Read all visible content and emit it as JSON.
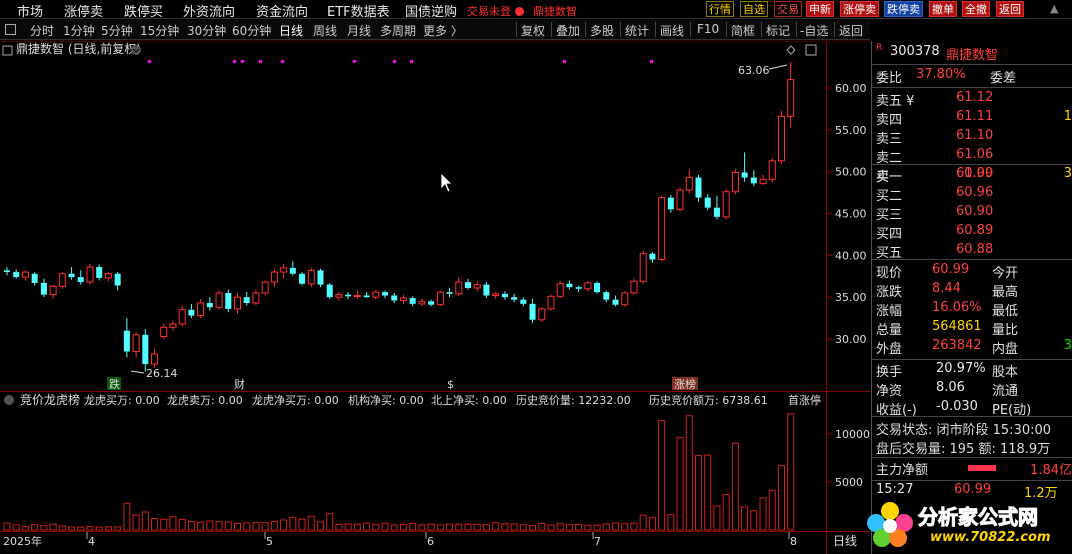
{
  "menu": {
    "items": [
      "市场",
      "涨停卖",
      "跌停买",
      "外资流向",
      "资金流向",
      "ETF数据表",
      "国债逆购"
    ],
    "notice": "交易未登",
    "stock_name": "鼎捷数智",
    "buttons": [
      "行情",
      "自选",
      "交易",
      "申新",
      "涨停卖",
      "跌停卖",
      "撤单",
      "全撤",
      "返回"
    ]
  },
  "periods": {
    "items": [
      "分时",
      "1分钟",
      "5分钟",
      "15分钟",
      "30分钟",
      "60分钟",
      "日线",
      "周线",
      "月线",
      "多周期",
      "更多 〉"
    ],
    "active": "日线",
    "tools": [
      "复权",
      "叠加",
      "多股",
      "统计",
      "画线",
      "F10",
      "简框",
      "标记",
      "-自选",
      "返回"
    ]
  },
  "chart": {
    "title": "鼎捷数智 (日线,前复权)",
    "high_label": "63.06",
    "low_label": "26.14",
    "price_ticks": [
      "60.00",
      "55.00",
      "50.00",
      "45.00",
      "40.00",
      "35.00",
      "30.00"
    ],
    "event_markers": [
      "跌",
      "财",
      "$",
      "涨榜"
    ],
    "indicator_name": "竞价龙虎榜",
    "indicator_fields": [
      {
        "label": "龙虎买万:",
        "value": "0.00",
        "color": "#e8e8e8"
      },
      {
        "label": "龙虎卖万:",
        "value": "0.00",
        "color": "#30a0ff"
      },
      {
        "label": "龙虎净买万:",
        "value": "0.00",
        "color": "#c040ff"
      },
      {
        "label": "机构净买:",
        "value": "0.00",
        "color": "#ff4040"
      },
      {
        "label": "北上净买:",
        "value": "0.00",
        "color": "#888888"
      },
      {
        "label": "历史竞价量:",
        "value": "12232.00",
        "color": "#3060ff"
      },
      {
        "label": "历史竞价额万:",
        "value": "6738.61",
        "color": "#e8e8e8"
      },
      {
        "label": "首涨停",
        "value": "",
        "color": "#ffd400"
      }
    ],
    "volume_ticks": [
      "10000",
      "5000"
    ],
    "date_labels": [
      "2025年",
      "4",
      "5",
      "6",
      "7",
      "8"
    ],
    "period_label": "日线"
  },
  "chart_data": {
    "type": "candlestick",
    "y_price_range": [
      26,
      64
    ],
    "y_volume_range": [
      0,
      13000
    ],
    "candles": [
      [
        38.2,
        38.6,
        37.6,
        38.0
      ],
      [
        38.0,
        38.3,
        37.2,
        37.4
      ],
      [
        37.4,
        38.2,
        37.0,
        38.0
      ],
      [
        37.8,
        38.0,
        36.4,
        36.7
      ],
      [
        36.7,
        37.2,
        35.0,
        35.3
      ],
      [
        35.3,
        36.5,
        34.8,
        36.3
      ],
      [
        36.3,
        38.0,
        36.0,
        37.8
      ],
      [
        37.8,
        38.6,
        37.1,
        37.4
      ],
      [
        37.4,
        38.2,
        36.5,
        36.8
      ],
      [
        36.8,
        39.0,
        36.5,
        38.6
      ],
      [
        38.6,
        38.9,
        37.0,
        37.3
      ],
      [
        37.3,
        38.0,
        36.9,
        37.8
      ],
      [
        37.8,
        38.0,
        35.8,
        36.4
      ],
      [
        31.0,
        32.5,
        27.8,
        28.5
      ],
      [
        28.5,
        30.8,
        27.8,
        30.5
      ],
      [
        30.5,
        31.2,
        26.1,
        27.0
      ],
      [
        27.0,
        28.8,
        26.6,
        28.2
      ],
      [
        30.3,
        31.8,
        30.0,
        31.4
      ],
      [
        31.4,
        32.2,
        31.0,
        31.8
      ],
      [
        31.8,
        34.0,
        31.5,
        33.5
      ],
      [
        33.5,
        34.2,
        32.5,
        32.8
      ],
      [
        32.8,
        34.8,
        32.5,
        34.3
      ],
      [
        34.3,
        35.0,
        33.4,
        33.8
      ],
      [
        33.8,
        35.8,
        33.5,
        35.5
      ],
      [
        35.5,
        35.9,
        33.2,
        33.6
      ],
      [
        33.6,
        35.5,
        33.0,
        35.0
      ],
      [
        35.0,
        35.6,
        34.0,
        34.3
      ],
      [
        34.3,
        35.9,
        34.0,
        35.5
      ],
      [
        35.5,
        37.0,
        35.2,
        36.8
      ],
      [
        36.8,
        38.4,
        36.2,
        38.0
      ],
      [
        38.0,
        39.0,
        37.3,
        38.5
      ],
      [
        38.5,
        39.3,
        37.6,
        37.8
      ],
      [
        37.8,
        38.0,
        36.4,
        36.6
      ],
      [
        36.6,
        38.5,
        36.2,
        38.2
      ],
      [
        38.2,
        38.4,
        36.2,
        36.5
      ],
      [
        36.5,
        36.7,
        34.8,
        35.0
      ],
      [
        35.0,
        35.6,
        34.6,
        35.3
      ],
      [
        35.3,
        35.6,
        34.8,
        35.1
      ],
      [
        35.1,
        35.8,
        34.8,
        35.2
      ],
      [
        35.2,
        35.6,
        34.9,
        35.0
      ],
      [
        35.0,
        35.9,
        34.7,
        35.6
      ],
      [
        35.6,
        35.8,
        34.9,
        35.2
      ],
      [
        35.2,
        35.5,
        34.3,
        34.6
      ],
      [
        34.6,
        35.3,
        34.2,
        34.9
      ],
      [
        34.9,
        35.1,
        33.9,
        34.2
      ],
      [
        34.2,
        34.8,
        33.9,
        34.5
      ],
      [
        34.5,
        34.7,
        33.9,
        34.1
      ],
      [
        34.1,
        35.8,
        33.9,
        35.6
      ],
      [
        35.6,
        36.1,
        35.0,
        35.4
      ],
      [
        35.4,
        37.4,
        35.1,
        36.8
      ],
      [
        36.8,
        37.2,
        35.9,
        36.1
      ],
      [
        36.1,
        36.9,
        35.7,
        36.5
      ],
      [
        36.5,
        36.8,
        34.9,
        35.2
      ],
      [
        35.2,
        35.6,
        34.8,
        35.4
      ],
      [
        35.4,
        35.7,
        34.7,
        35.0
      ],
      [
        35.0,
        35.4,
        34.4,
        34.7
      ],
      [
        34.7,
        35.0,
        33.9,
        34.2
      ],
      [
        34.2,
        34.8,
        31.9,
        32.3
      ],
      [
        32.3,
        33.8,
        32.1,
        33.6
      ],
      [
        33.6,
        35.3,
        33.4,
        35.1
      ],
      [
        35.1,
        36.9,
        34.9,
        36.6
      ],
      [
        36.6,
        37.0,
        35.9,
        36.2
      ],
      [
        36.2,
        36.4,
        35.6,
        36.0
      ],
      [
        36.0,
        36.9,
        35.7,
        36.7
      ],
      [
        36.7,
        36.9,
        35.4,
        35.6
      ],
      [
        35.6,
        35.8,
        34.4,
        34.7
      ],
      [
        34.7,
        35.2,
        33.9,
        34.1
      ],
      [
        34.1,
        35.7,
        33.9,
        35.5
      ],
      [
        35.5,
        37.2,
        35.3,
        36.9
      ],
      [
        36.9,
        40.6,
        36.6,
        40.2
      ],
      [
        40.2,
        40.4,
        39.1,
        39.5
      ],
      [
        39.5,
        47.1,
        39.3,
        46.9
      ],
      [
        46.9,
        47.2,
        45.1,
        45.5
      ],
      [
        45.5,
        48.2,
        45.2,
        47.8
      ],
      [
        47.8,
        50.3,
        47.4,
        49.3
      ],
      [
        49.3,
        49.6,
        46.4,
        46.9
      ],
      [
        46.9,
        47.3,
        45.4,
        45.7
      ],
      [
        45.7,
        47.1,
        44.3,
        44.6
      ],
      [
        44.6,
        47.9,
        44.3,
        47.6
      ],
      [
        47.6,
        50.3,
        47.3,
        49.9
      ],
      [
        49.9,
        52.3,
        48.8,
        49.3
      ],
      [
        49.3,
        50.2,
        48.3,
        48.6
      ],
      [
        48.6,
        49.6,
        48.4,
        49.1
      ],
      [
        49.1,
        51.6,
        48.7,
        51.3
      ],
      [
        51.3,
        57.3,
        50.9,
        56.6
      ],
      [
        56.6,
        63.1,
        55.3,
        61.0
      ]
    ],
    "volumes": [
      720,
      540,
      360,
      550,
      470,
      610,
      420,
      320,
      300,
      370,
      310,
      330,
      320,
      2750,
      1560,
      1880,
      1200,
      1120,
      1380,
      1100,
      880,
      820,
      930,
      870,
      830,
      700,
      740,
      780,
      760,
      880,
      1050,
      1320,
      1130,
      1430,
      860,
      1700,
      580,
      640,
      600,
      710,
      600,
      700,
      520,
      560,
      690,
      540,
      620,
      530,
      600,
      610,
      610,
      590,
      550,
      760,
      660,
      640,
      550,
      470,
      690,
      510,
      660,
      590,
      580,
      500,
      500,
      640,
      730,
      650,
      720,
      1550,
      1280,
      11400,
      1600,
      9650,
      11900,
      7750,
      7800,
      2500,
      3700,
      9050,
      2400,
      2000,
      3350,
      4150,
      6700,
      12100
    ]
  },
  "panel": {
    "code": "300378",
    "name": "鼎捷数智",
    "wei_bi_label": "委比",
    "wei_bi": "37.80%",
    "wei_cha_label": "委差",
    "sell": [
      {
        "label": "卖五 ¥",
        "price": "61.12",
        "vol": ""
      },
      {
        "label": "卖四",
        "price": "61.11",
        "vol": "1"
      },
      {
        "label": "卖三",
        "price": "61.10",
        "vol": ""
      },
      {
        "label": "卖二",
        "price": "61.06",
        "vol": ""
      },
      {
        "label": "卖一",
        "price": "61.00",
        "vol": ""
      }
    ],
    "buy": [
      {
        "label": "买一",
        "price": "60.99",
        "vol": "3"
      },
      {
        "label": "买二",
        "price": "60.96",
        "vol": ""
      },
      {
        "label": "买三",
        "price": "60.90",
        "vol": ""
      },
      {
        "label": "买四",
        "price": "60.89",
        "vol": ""
      },
      {
        "label": "买五",
        "price": "60.88",
        "vol": ""
      }
    ],
    "quote": [
      {
        "l1": "现价",
        "v1": "60.99",
        "c1": "red",
        "l2": "今开",
        "v2": "",
        "c2": "red"
      },
      {
        "l1": "涨跌",
        "v1": "8.44",
        "c1": "red",
        "l2": "最高",
        "v2": "",
        "c2": "red"
      },
      {
        "l1": "涨幅",
        "v1": "16.06%",
        "c1": "red",
        "l2": "最低",
        "v2": "",
        "c2": "red"
      },
      {
        "l1": "总量",
        "v1": "564861",
        "c1": "yel",
        "l2": "量比",
        "v2": "",
        "c2": "wht"
      },
      {
        "l1": "外盘",
        "v1": "263842",
        "c1": "red",
        "l2": "内盘",
        "v2": "3",
        "c2": "grn"
      }
    ],
    "fundamentals": [
      {
        "l1": "换手",
        "v1": "20.97%",
        "l2": "股本"
      },
      {
        "l1": "净资",
        "v1": "8.06",
        "l2": "流通"
      },
      {
        "l1": "收益(-)",
        "v1": "-0.030",
        "l2": "PE(动)"
      }
    ],
    "trade_status": "交易状态: 闭市阶段 15:30:00",
    "after_hours": "盘后交易量: 195  额: 118.9万",
    "main_net_label": "主力净额",
    "main_net_value": "1.84亿",
    "tick_time": "15:27",
    "tick_price": "60.99",
    "tick_vol": "1.2万"
  },
  "watermark": {
    "text": "分析家公式网",
    "url": "www.70822.com"
  },
  "colors": {
    "up": "#ff3232",
    "down": "#54ffff",
    "volume_bar": "#d02020",
    "grid": "#8b0000",
    "marker_magenta": "#ff00ff"
  }
}
